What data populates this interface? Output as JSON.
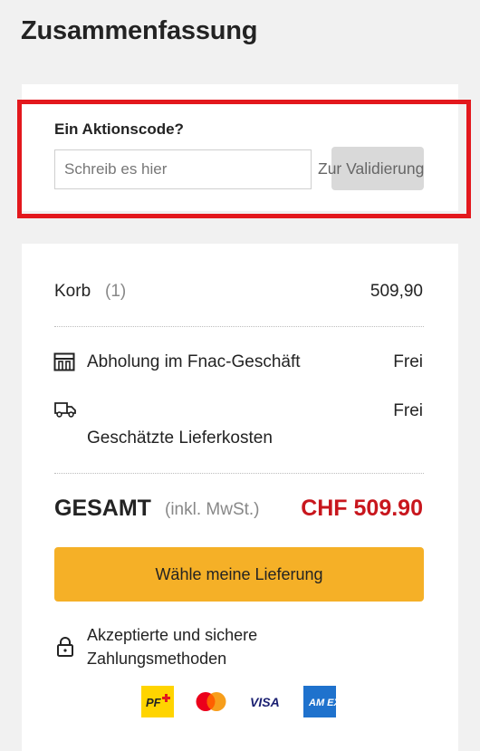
{
  "page_title": "Zusammenfassung",
  "promo": {
    "label": "Ein Aktionscode?",
    "input_placeholder": "Schreib es hier",
    "input_value": "",
    "validate_label": "Zur Validierung"
  },
  "summary": {
    "basket_label": "Korb",
    "basket_count": "(1)",
    "basket_amount": "509,90",
    "pickup_label": "Abholung im Fnac-Geschäft",
    "pickup_price": "Frei",
    "delivery_label": "Geschätzte Lieferkosten",
    "delivery_price": "Frei",
    "total_label": "GESAMT",
    "total_note": "(inkl. MwSt.)",
    "total_price": "CHF 509.90",
    "cta_label": "Wähle meine Lieferung",
    "secure_label": "Akzeptierte und sichere Zahlungsmethoden"
  },
  "payment_methods": [
    "PostFinance",
    "Mastercard",
    "VISA",
    "American Express"
  ],
  "payment_labels": {
    "postfinance": "PF",
    "visa": "VISA",
    "amex": "AM EX"
  },
  "colors": {
    "accent_red": "#e3181d",
    "price_red": "#c8161d",
    "cta_yellow": "#f5b027",
    "background": "#f1f1f1"
  }
}
